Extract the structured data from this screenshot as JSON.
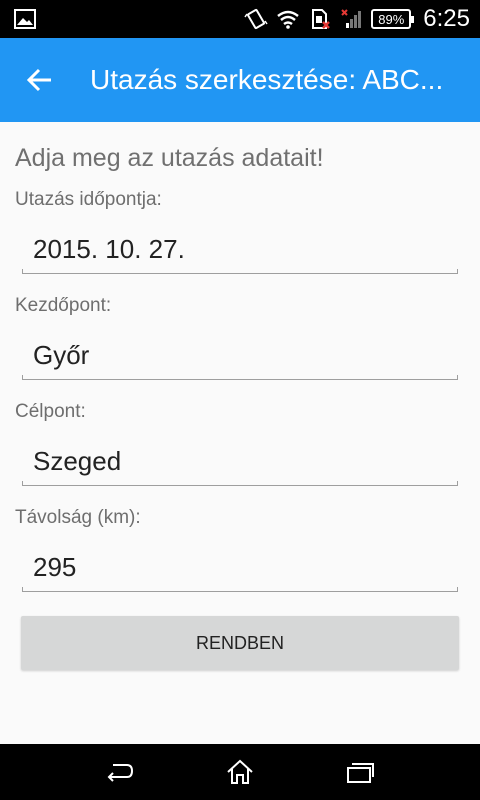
{
  "status_bar": {
    "battery": "89%",
    "time": "6:25"
  },
  "app_bar": {
    "title": "Utazás szerkesztése: ABC..."
  },
  "form": {
    "heading": "Adja meg az utazás adatait!",
    "date_label": "Utazás időpontja:",
    "date_value": "2015. 10. 27.",
    "start_label": "Kezdőpont:",
    "start_value": "Győr",
    "destination_label": "Célpont:",
    "destination_value": "Szeged",
    "distance_label": "Távolság (km):",
    "distance_value": "295",
    "ok_button": "RENDBEN"
  },
  "colors": {
    "app_bar": "#2196f3",
    "status_bar": "#000000",
    "background": "#fafafa",
    "button": "#d6d7d7"
  },
  "icons": [
    "image-icon",
    "vibrate-icon",
    "wifi-icon",
    "sim-icon",
    "signal-icon",
    "battery-icon",
    "back-arrow-icon",
    "nav-back-icon",
    "nav-home-icon",
    "nav-recents-icon"
  ]
}
